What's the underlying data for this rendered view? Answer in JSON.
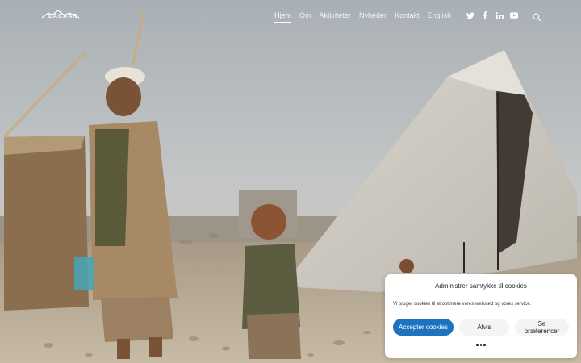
{
  "site": {
    "logo_text": "DACAAR"
  },
  "nav": {
    "items": [
      {
        "label": "Hjem",
        "active": true
      },
      {
        "label": "Om",
        "active": false
      },
      {
        "label": "Aktiviteter",
        "active": false
      },
      {
        "label": "Nyheder",
        "active": false
      },
      {
        "label": "Kontakt",
        "active": false
      },
      {
        "label": "English",
        "active": false
      }
    ]
  },
  "social": {
    "icons": [
      "twitter-icon",
      "facebook-icon",
      "linkedin-icon",
      "youtube-icon"
    ]
  },
  "cookie": {
    "title": "Administrer samtykke til cookies",
    "text": "Vi bruger cookies til at optimere vores websted og vores service.",
    "accept_label": "Accepter cookies",
    "deny_label": "Afvis",
    "prefs_label": "Se præferencer"
  },
  "colors": {
    "accent": "#1e73be"
  }
}
